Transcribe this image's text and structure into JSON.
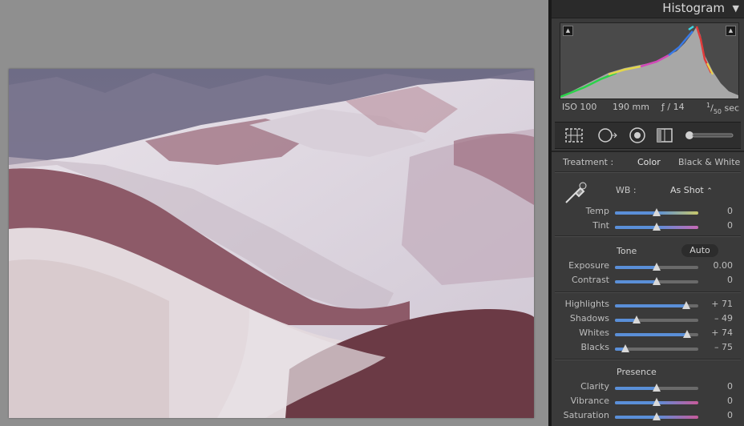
{
  "histogram": {
    "title": "Histogram",
    "iso": "ISO 100",
    "focal_length": "190 mm",
    "aperture": "ƒ / 14",
    "shutter_num": "1",
    "shutter_den": "50",
    "shutter_unit": "sec"
  },
  "treatment": {
    "label": "Treatment :",
    "color": "Color",
    "bw": "Black & White"
  },
  "wb": {
    "label": "WB :",
    "value": "As Shot",
    "arrows": "⌃"
  },
  "sliders_wb": [
    {
      "label": "Temp",
      "value": "0",
      "pos": 0.5
    },
    {
      "label": "Tint",
      "value": "0",
      "pos": 0.5
    }
  ],
  "tone": {
    "label": "Tone",
    "auto": "Auto"
  },
  "sliders_tone1": [
    {
      "label": "Exposure",
      "value": "0.00",
      "pos": 0.5
    },
    {
      "label": "Contrast",
      "value": "0",
      "pos": 0.5
    }
  ],
  "sliders_tone2": [
    {
      "label": "Highlights",
      "value": "+ 71",
      "pos": 0.855
    },
    {
      "label": "Shadows",
      "value": "– 49",
      "pos": 0.255
    },
    {
      "label": "Whites",
      "value": "+ 74",
      "pos": 0.87
    },
    {
      "label": "Blacks",
      "value": "– 75",
      "pos": 0.125
    }
  ],
  "presence": {
    "label": "Presence"
  },
  "sliders_presence": [
    {
      "label": "Clarity",
      "value": "0",
      "pos": 0.5
    },
    {
      "label": "Vibrance",
      "value": "0",
      "pos": 0.5
    },
    {
      "label": "Saturation",
      "value": "0",
      "pos": 0.5
    }
  ],
  "colors": {
    "slider_fill": "#5a8fd8",
    "panel_bg": "#3a3a3a",
    "viewer_bg": "#8f8f8f"
  }
}
